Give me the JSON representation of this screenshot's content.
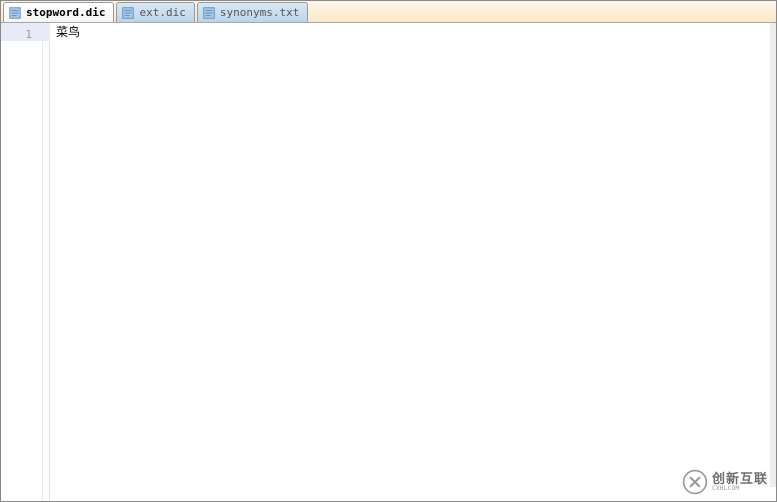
{
  "tabs": [
    {
      "label": "stopword.dic",
      "active": true
    },
    {
      "label": "ext.dic",
      "active": false
    },
    {
      "label": "synonyms.txt",
      "active": false
    }
  ],
  "editor": {
    "lines": [
      {
        "number": "1",
        "text": "菜鸟"
      }
    ]
  },
  "watermark": {
    "cn": "创新互联",
    "en": "CXHLCOM"
  }
}
